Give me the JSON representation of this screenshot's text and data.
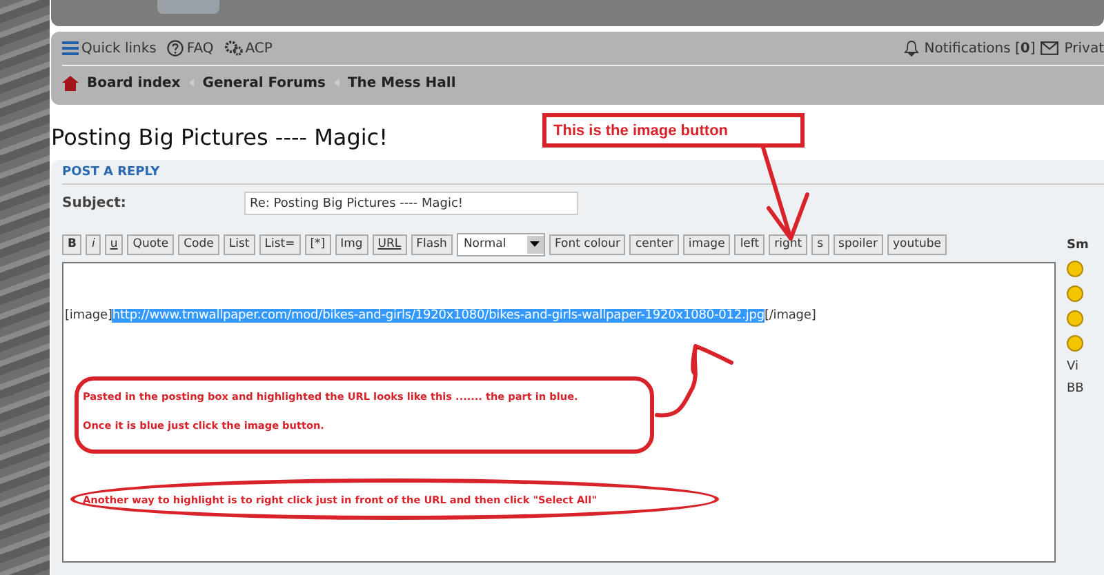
{
  "nav": {
    "links": [
      {
        "label": "Quick links",
        "kind": "menu"
      },
      {
        "label": "FAQ",
        "kind": "help"
      },
      {
        "label": "ACP",
        "kind": "gears"
      }
    ],
    "notifications": {
      "label": "Notifications [**0**]"
    },
    "private_messages": "Privat"
  },
  "breadcrumbs": [
    "Board index",
    "General Forums",
    "The Mess Hall"
  ],
  "page_title": "Posting Big Pictures ---- Magic!",
  "post_panel": {
    "heading": "POST A REPLY",
    "subject_label": "Subject:",
    "subject_value": "Re: Posting Big Pictures ---- Magic!",
    "toolbar": [
      {
        "label": "B",
        "kind": "bold"
      },
      {
        "label": "i",
        "kind": "italic"
      },
      {
        "label": "u",
        "kind": "underline"
      },
      {
        "label": "Quote",
        "kind": "plain"
      },
      {
        "label": "Code",
        "kind": "plain"
      },
      {
        "label": "List",
        "kind": "plain"
      },
      {
        "label": "List=",
        "kind": "plain"
      },
      {
        "label": "[*]",
        "kind": "plain"
      },
      {
        "label": "Img",
        "kind": "plain"
      },
      {
        "label": "URL",
        "kind": "underline"
      },
      {
        "label": "Flash",
        "kind": "plain"
      },
      {
        "label": "Normal",
        "kind": "select"
      },
      {
        "label": "Font colour",
        "kind": "plain"
      },
      {
        "label": "center",
        "kind": "plain"
      },
      {
        "label": "image",
        "kind": "plain"
      },
      {
        "label": "left",
        "kind": "plain"
      },
      {
        "label": "right",
        "kind": "plain"
      },
      {
        "label": "s",
        "kind": "plain"
      },
      {
        "label": "spoiler",
        "kind": "plain"
      },
      {
        "label": "youtube",
        "kind": "plain"
      }
    ],
    "editor": {
      "before": "[image]",
      "selected": "http://www.tmwallpaper.com/mod/bikes-and-girls/1920x1080/bikes-and-girls-wallpaper-1920x1080-012.jpg",
      "after": "[/image]"
    }
  },
  "sidebar": {
    "heading": "Sm",
    "link": "Vi",
    "footer": "BB"
  },
  "annotations": {
    "callout": "This is the image button",
    "note_lines": [
      "Pasted in the posting box and highlighted the URL looks like this ....... the part in blue.",
      "Once it is blue just click the image button."
    ],
    "tip": "Another way to highlight is to right click just in front of the URL and then click \"Select All\""
  }
}
